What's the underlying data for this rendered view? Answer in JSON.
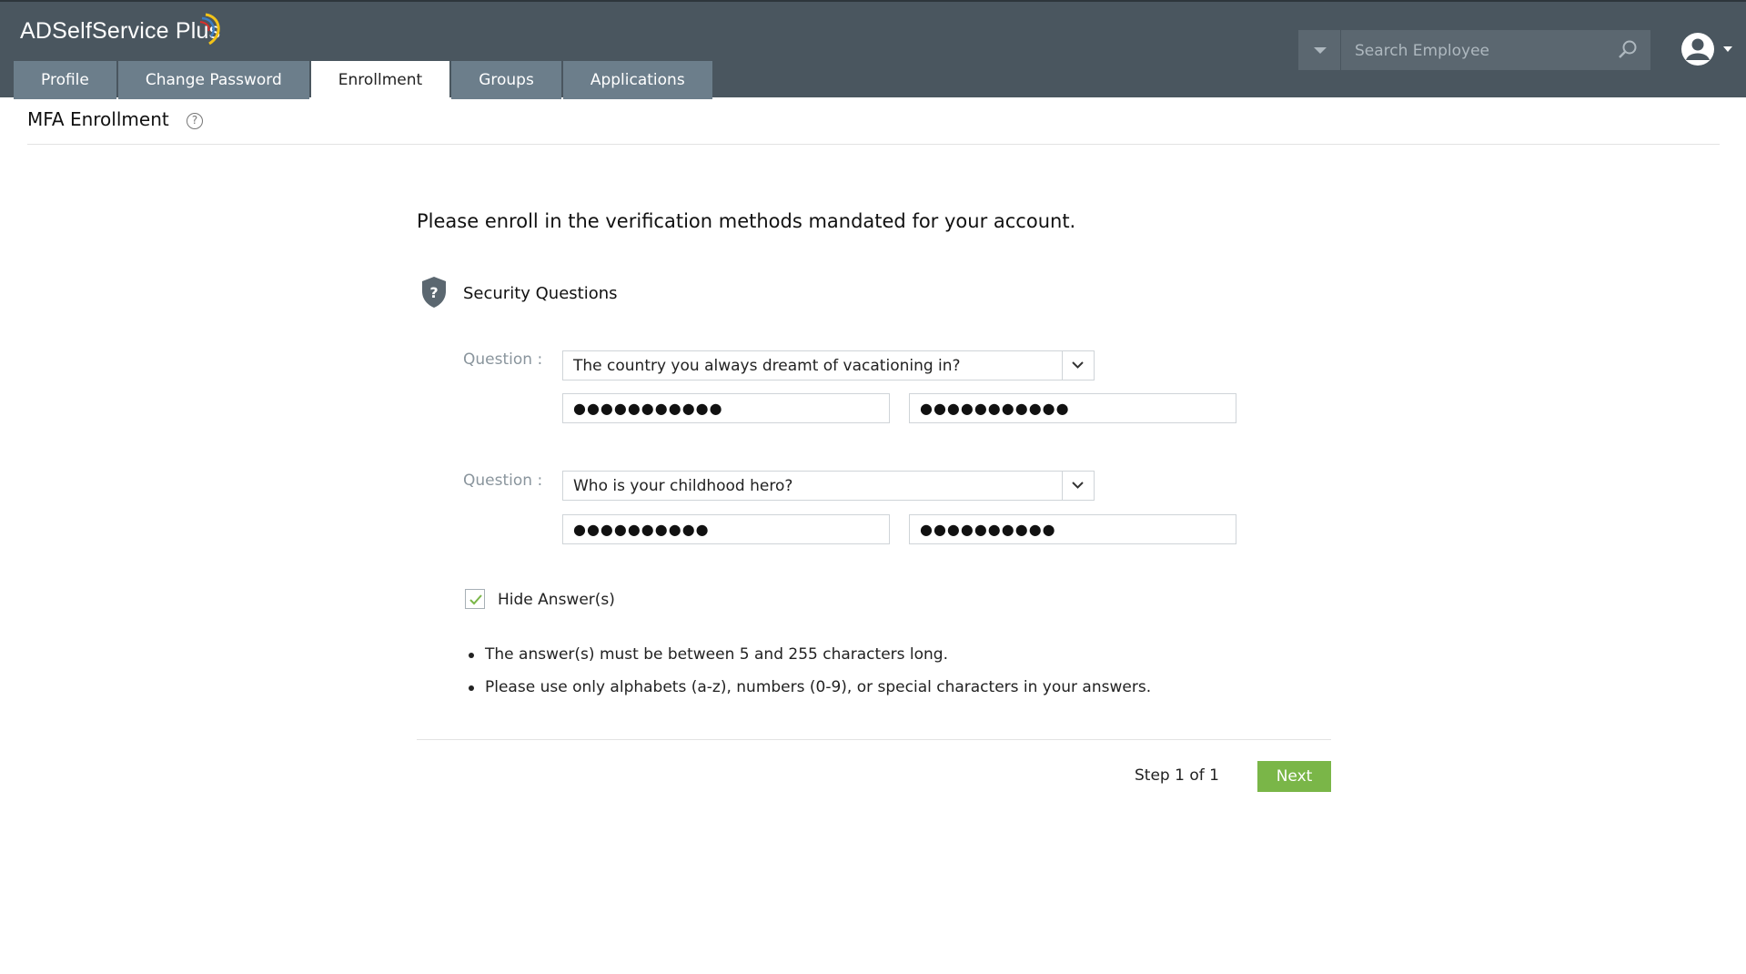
{
  "app": {
    "logo_text": "ADSelfService Plus"
  },
  "nav": {
    "tabs": [
      {
        "label": "Profile",
        "active": false
      },
      {
        "label": "Change Password",
        "active": false
      },
      {
        "label": "Enrollment",
        "active": true
      },
      {
        "label": "Groups",
        "active": false
      },
      {
        "label": "Applications",
        "active": false
      }
    ]
  },
  "search": {
    "placeholder": "Search Employee",
    "value": ""
  },
  "page": {
    "title": "MFA Enrollment",
    "help_icon": "question-circle-icon"
  },
  "main": {
    "intro": "Please enroll in the verification methods mandated for your account.",
    "section_icon": "shield-question-icon",
    "section_title": "Security Questions",
    "questions": [
      {
        "label": "Question :",
        "selected": "The country you always dreamt of vacationing in?",
        "answer_masked": "●●●●●●●●●●●",
        "confirm_masked": "●●●●●●●●●●●"
      },
      {
        "label": "Question :",
        "selected": "Who is your childhood hero?",
        "answer_masked": "●●●●●●●●●●",
        "confirm_masked": "●●●●●●●●●●"
      }
    ],
    "hide_answers": {
      "label": "Hide Answer(s)",
      "checked": true
    },
    "rules": [
      "The answer(s) must be between 5 and 255 characters long.",
      "Please use only alphabets (a-z), numbers (0-9), or special characters in your answers."
    ],
    "step_text": "Step 1 of 1",
    "next_label": "Next"
  },
  "colors": {
    "header_bg": "#4a565f",
    "tab_bg": "#6c7e8b",
    "accent_green": "#7ab648"
  }
}
